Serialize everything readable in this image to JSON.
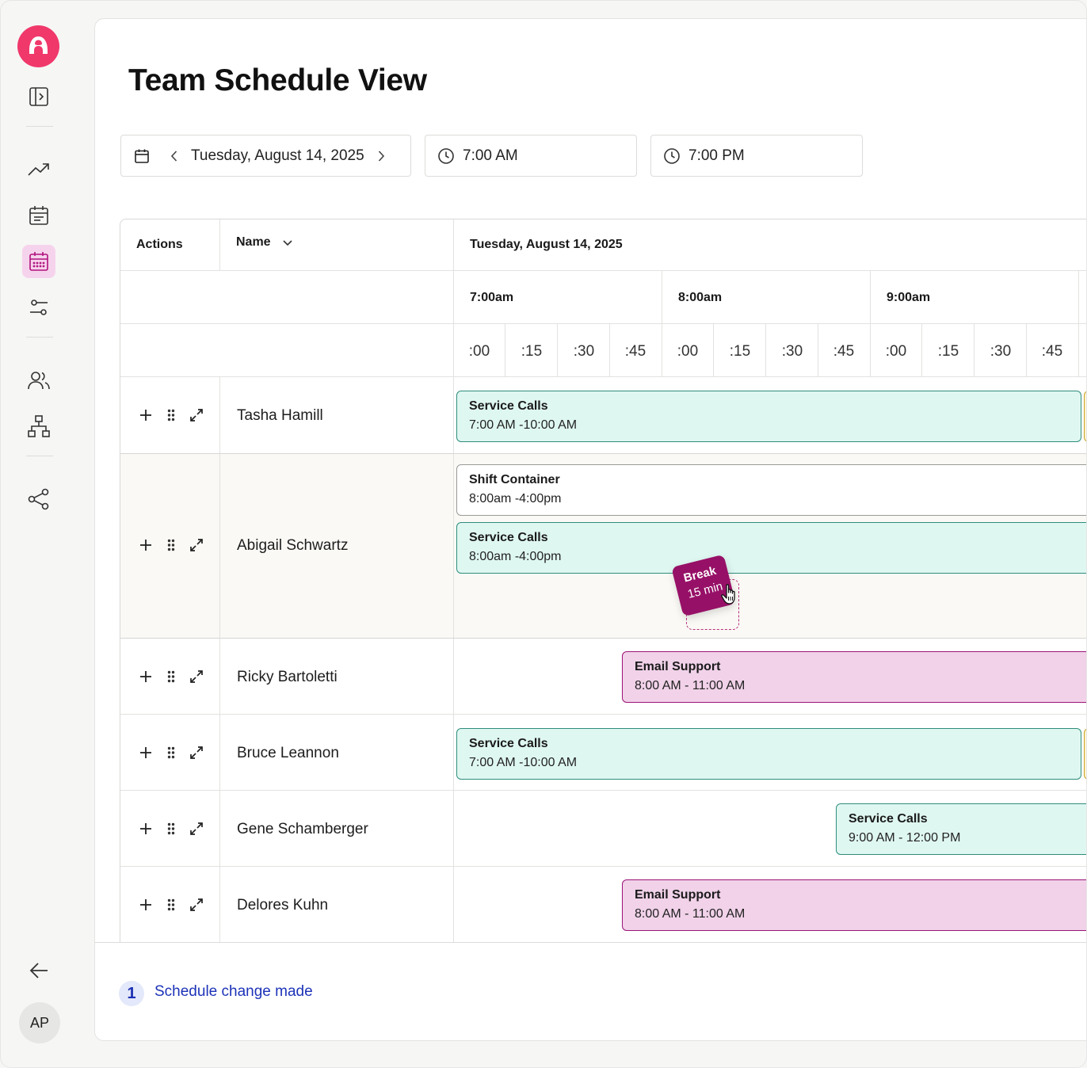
{
  "sidebar": {
    "icons": [
      "logo-icon",
      "panel-expand-icon",
      "trending-icon",
      "schedule-list-icon",
      "calendar-icon",
      "sliders-icon",
      "users-icon",
      "org-chart-icon",
      "share-icon",
      "back-arrow-icon"
    ],
    "avatar_initials": "AP"
  },
  "page": {
    "title": "Team Schedule View"
  },
  "filters": {
    "date": "Tuesday, August 14, 2025",
    "start_time": "7:00 AM",
    "end_time": "7:00 PM"
  },
  "table": {
    "col_actions": "Actions",
    "col_name": "Name",
    "col_date": "Tuesday, August 14, 2025",
    "hours": [
      "7:00am",
      "8:00am",
      "9:00am"
    ],
    "quarters": [
      ":00",
      ":15",
      ":30",
      ":45",
      ":00",
      ":15",
      ":30",
      ":45",
      ":00",
      ":15",
      ":30",
      ":45"
    ],
    "rows": [
      {
        "name": "Tasha Hamill",
        "blocks": [
          {
            "title": "Service Calls",
            "time": "7:00 AM -10:00 AM"
          }
        ]
      },
      {
        "name": "Abigail Schwartz",
        "blocks": [
          {
            "title": "Shift Container",
            "time": "8:00am -4:00pm"
          },
          {
            "title": "Service Calls",
            "time": "8:00am -4:00pm"
          }
        ]
      },
      {
        "name": "Ricky Bartoletti",
        "blocks": [
          {
            "title": "Email Support",
            "time": "8:00 AM - 11:00 AM"
          }
        ]
      },
      {
        "name": "Bruce Leannon",
        "blocks": [
          {
            "title": "Service Calls",
            "time": "7:00 AM -10:00 AM"
          }
        ]
      },
      {
        "name": "Gene Schamberger",
        "blocks": [
          {
            "title": "Service Calls",
            "time": "9:00 AM - 12:00 PM"
          }
        ]
      },
      {
        "name": "Delores Kuhn",
        "blocks": [
          {
            "title": "Email Support",
            "time": "8:00 AM - 11:00 AM"
          }
        ]
      }
    ],
    "break_chip": {
      "title": "Break",
      "duration": "15 min"
    }
  },
  "footer": {
    "count": "1",
    "message": "Schedule change made"
  },
  "colors": {
    "accent": "#f0386b",
    "teal_block": "#dff7f1",
    "pink_block": "#f1d2e9",
    "break_chip": "#971067",
    "link": "#1d33b8"
  }
}
